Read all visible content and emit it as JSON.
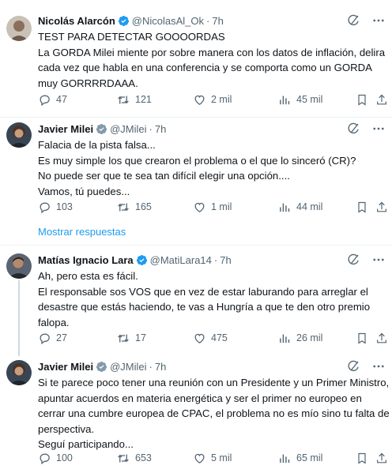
{
  "tweets": [
    {
      "name": "Nicolás Alarcón",
      "handle": "@NicolasAl_Ok",
      "time": "7h",
      "lines": [
        "TEST PARA DETECTAR GOOOORDAS",
        "La GORDA Milei miente por sobre manera con los datos de inflación, delira",
        "cada vez que habla en una conferencia y se comporta como un GORDA",
        "muy GORRRRDAAA."
      ],
      "replies": "47",
      "retweets": "121",
      "likes": "2 mil",
      "views": "45 mil"
    },
    {
      "name": "Javier Milei",
      "handle": "@JMilei",
      "time": "7h",
      "lines": [
        "Falacia de la pista falsa...",
        "Es muy simple los que crearon el problema o el que lo sinceró (CR)?",
        "No puede ser que te sea tan difícil elegir una opción....",
        "Vamos, tú puedes..."
      ],
      "replies": "103",
      "retweets": "165",
      "likes": "1 mil",
      "views": "44 mil"
    },
    {
      "name": "Matías Ignacio Lara",
      "handle": "@MatiLara14",
      "time": "7h",
      "lines": [
        "Ah, pero esta es fácil.",
        "El responsable sos VOS que en vez de estar laburando para arreglar el",
        "desastre que estás haciendo, te vas a Hungría a que te den otro premio",
        "falopa."
      ],
      "replies": "27",
      "retweets": "17",
      "likes": "475",
      "views": "26 mil"
    },
    {
      "name": "Javier Milei",
      "handle": "@JMilei",
      "time": "7h",
      "lines": [
        "Si te parece poco tener una reunión con un Presidente y un Primer Ministro,",
        "apuntar acuerdos en materia energética y ser el primer no europeo en",
        "cerrar una cumbre europea de CPAC, el problema no es mío sino tu falta de",
        "perspectiva.",
        "Seguí participando..."
      ],
      "replies": "100",
      "retweets": "653",
      "likes": "5 mil",
      "views": "65 mil"
    }
  ],
  "show_replies_label": "Mostrar respuestas",
  "colors": {
    "accent": "#1d9bf0",
    "muted": "#536471",
    "text": "#0f1419"
  }
}
